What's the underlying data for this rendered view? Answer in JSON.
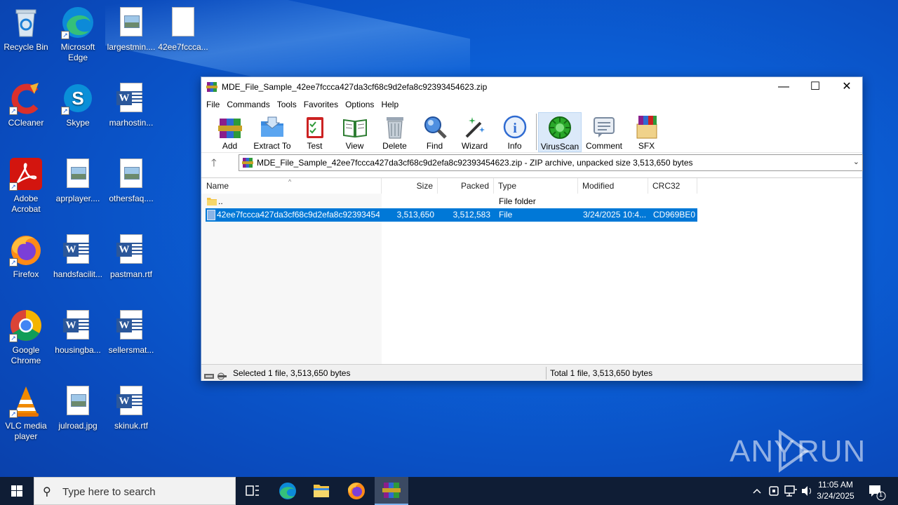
{
  "desktop": {
    "icons": [
      {
        "label": "Recycle Bin"
      },
      {
        "label": "Microsoft Edge"
      },
      {
        "label": "largestmin...."
      },
      {
        "label": "42ee7fccca..."
      },
      {
        "label": "CCleaner"
      },
      {
        "label": "Skype"
      },
      {
        "label": "marhostin..."
      },
      {
        "label": "Adobe Acrobat"
      },
      {
        "label": "aprplayer...."
      },
      {
        "label": "othersfaq...."
      },
      {
        "label": "Firefox"
      },
      {
        "label": "handsfacilit..."
      },
      {
        "label": "pastman.rtf"
      },
      {
        "label": "Google Chrome"
      },
      {
        "label": "housingba..."
      },
      {
        "label": "sellersmat..."
      },
      {
        "label": "VLC media player"
      },
      {
        "label": "julroad.jpg"
      },
      {
        "label": "skinuk.rtf"
      }
    ]
  },
  "window": {
    "title": "MDE_File_Sample_42ee7fccca427da3cf68c9d2efa8c92393454623.zip",
    "menu": [
      "File",
      "Commands",
      "Tools",
      "Favorites",
      "Options",
      "Help"
    ],
    "toolbar": [
      "Add",
      "Extract To",
      "Test",
      "View",
      "Delete",
      "Find",
      "Wizard",
      "Info",
      "VirusScan",
      "Comment",
      "SFX"
    ],
    "address": "MDE_File_Sample_42ee7fccca427da3cf68c9d2efa8c92393454623.zip - ZIP archive, unpacked size 3,513,650 bytes",
    "columns": [
      "Name",
      "Size",
      "Packed",
      "Type",
      "Modified",
      "CRC32"
    ],
    "rows": [
      {
        "name": "..",
        "size": "",
        "packed": "",
        "type": "File folder",
        "modified": "",
        "crc": ""
      },
      {
        "name": "42ee7fccca427da3cf68c9d2efa8c92393454...",
        "size": "3,513,650",
        "packed": "3,512,583",
        "type": "File",
        "modified": "3/24/2025 10:4...",
        "crc": "CD969BE0"
      }
    ],
    "status_left": "Selected 1 file, 3,513,650 bytes",
    "status_right": "Total 1 file, 3,513,650 bytes"
  },
  "watermark": "ANY RUN",
  "taskbar": {
    "search_placeholder": "Type here to search",
    "time": "11:05 AM",
    "date": "3/24/2025",
    "notification_count": "1"
  }
}
